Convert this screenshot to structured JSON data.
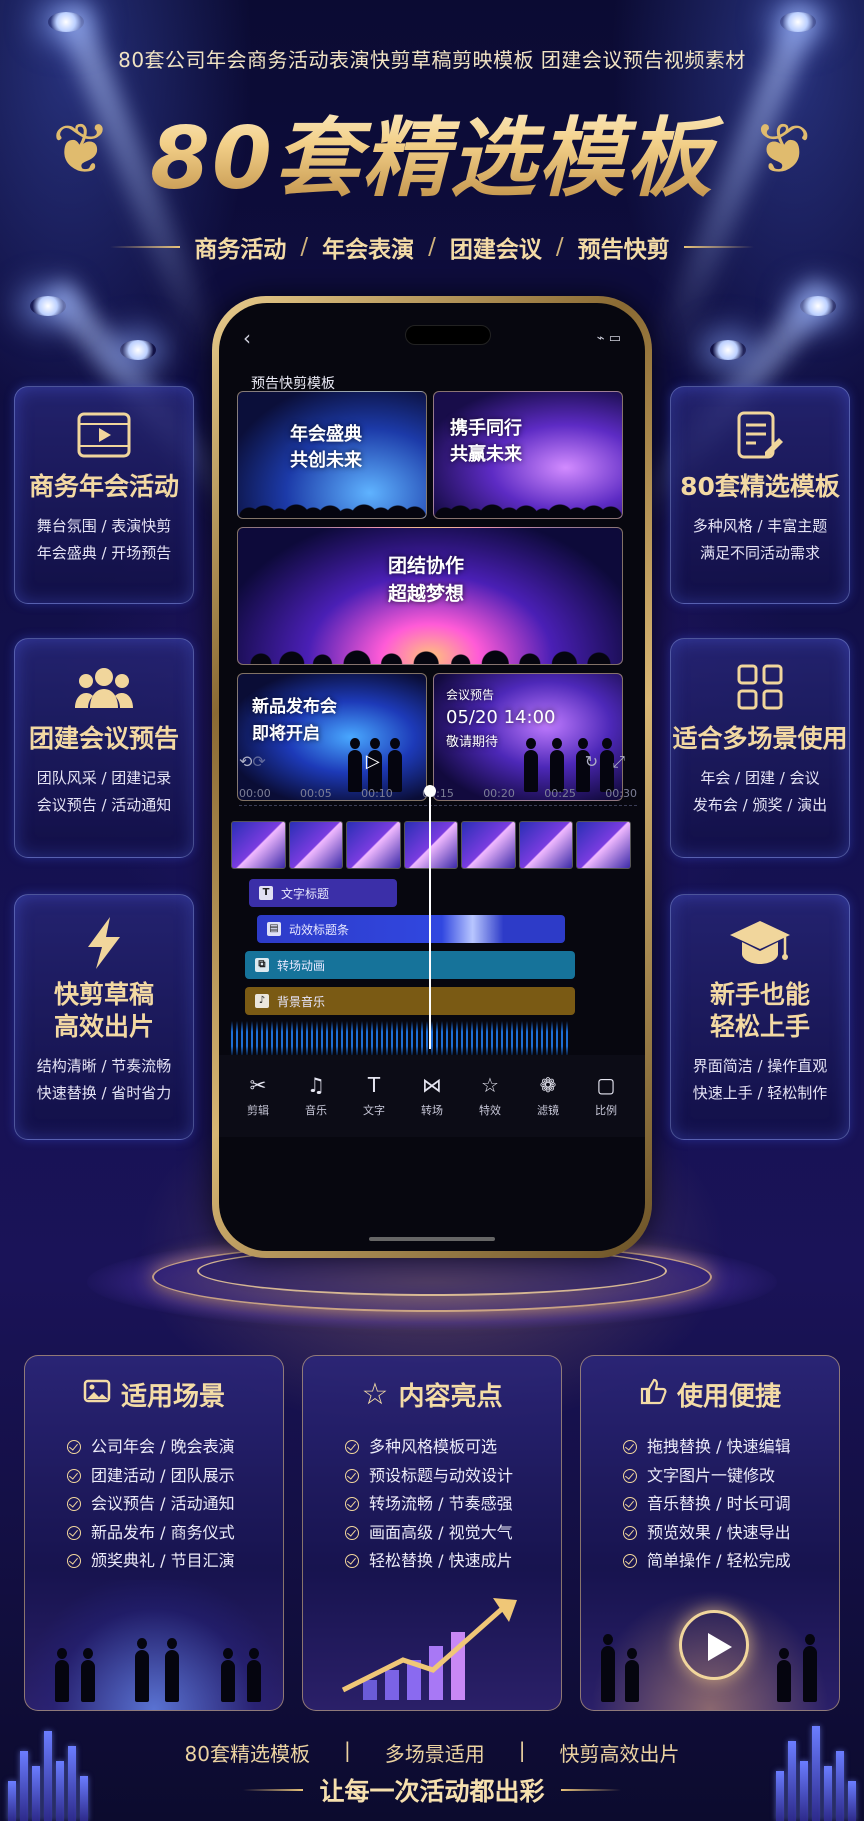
{
  "header": {
    "top_line": "80套公司年会商务活动表演快剪草稿剪映模板 团建会议预告视频素材",
    "headline": "80套精选模板",
    "sub_items": [
      "商务活动",
      "年会表演",
      "团建会议",
      "预告快剪"
    ],
    "separator": "/"
  },
  "left_cards": [
    {
      "icon": "video-play-icon",
      "title": "商务年会活动",
      "line1": "舞台氛围 / 表演快剪",
      "line2": "年会盛典 / 开场预告"
    },
    {
      "icon": "people-group-icon",
      "title": "团建会议预告",
      "line1": "团队风采 / 团建记录",
      "line2": "会议预告 / 活动通知"
    },
    {
      "icon": "lightning-icon",
      "title": "快剪草稿\n高效出片",
      "title_a": "快剪草稿",
      "title_b": "高效出片",
      "line1": "结构清晰 / 节奏流畅",
      "line2": "快速替换 / 省时省力"
    }
  ],
  "right_cards": [
    {
      "icon": "document-edit-icon",
      "title": "80套精选模板",
      "line1": "多种风格 / 丰富主题",
      "line2": "满足不同活动需求"
    },
    {
      "icon": "grid-icon",
      "title": "适合多场景使用",
      "line1": "年会 / 团建 / 会议",
      "line2": "发布会 / 颁奖 / 演出"
    },
    {
      "icon": "graduation-cap-icon",
      "title_a": "新手也能",
      "title_b": "轻松上手",
      "line1": "界面简洁 / 操作直观",
      "line2": "快速上手 / 轻松制作"
    }
  ],
  "phone": {
    "back_glyph": "‹",
    "status_right": "⌁ ▭",
    "section_title": "预告快剪模板",
    "templates": [
      {
        "line1": "年会盛典",
        "line2": "共创未来"
      },
      {
        "line1": "携手同行",
        "line2": "共赢未来"
      },
      {
        "line1": "团结协作",
        "line2": "超越梦想"
      },
      {
        "line1": "新品发布会",
        "line2": "即将开启"
      },
      {
        "line1": "会议预告",
        "line2": "05/20  14:00",
        "line3": "敬请期待"
      }
    ],
    "timeline_marks": [
      "00:00",
      "00:05",
      "00:10",
      "00:15",
      "00:20",
      "00:25",
      "00:30"
    ],
    "tracks": [
      {
        "icon": "T",
        "label": "文字标题",
        "color": "#3b2fa8"
      },
      {
        "icon": "▤",
        "label": "动效标题条",
        "color": "#2d3bc8"
      },
      {
        "icon": "⧉",
        "label": "转场动画",
        "color": "#16739a"
      },
      {
        "icon": "♪",
        "label": "背景音乐",
        "color": "#7a5a14"
      }
    ],
    "tools": [
      {
        "glyph": "✂",
        "label": "剪辑",
        "icon": "scissors-icon"
      },
      {
        "glyph": "♫",
        "label": "音乐",
        "icon": "music-icon"
      },
      {
        "glyph": "T",
        "label": "文字",
        "icon": "text-icon"
      },
      {
        "glyph": "⋈",
        "label": "转场",
        "icon": "transition-icon"
      },
      {
        "glyph": "☆",
        "label": "特效",
        "icon": "star-icon"
      },
      {
        "glyph": "❁",
        "label": "滤镜",
        "icon": "filter-icon"
      },
      {
        "glyph": "▢",
        "label": "比例",
        "icon": "ratio-icon"
      }
    ]
  },
  "bottom_cards": [
    {
      "icon": "image-icon",
      "glyph": "▣",
      "title": "适用场景",
      "items": [
        "公司年会 / 晚会表演",
        "团建活动 / 团队展示",
        "会议预告 / 活动通知",
        "新品发布 / 商务仪式",
        "颁奖典礼 / 节目汇演"
      ]
    },
    {
      "icon": "star-outline-icon",
      "glyph": "☆",
      "title": "内容亮点",
      "items": [
        "多种风格模板可选",
        "预设标题与动效设计",
        "转场流畅 / 节奏感强",
        "画面高级 / 视觉大气",
        "轻松替换 / 快速成片"
      ]
    },
    {
      "icon": "thumbs-up-icon",
      "glyph": "👍",
      "title": "使用便捷",
      "items": [
        "拖拽替换 / 快速编辑",
        "文字图片一键修改",
        "音乐替换 / 时长可调",
        "预览效果 / 快速导出",
        "简单操作 / 轻松完成"
      ]
    }
  ],
  "footer": {
    "tags": [
      "80套精选模板",
      "|",
      "多场景适用",
      "|",
      "快剪高效出片"
    ],
    "slogan": "让每一次活动都出彩"
  },
  "colors": {
    "gold": "#f3d9a3",
    "navy": "#0a0a2c",
    "accent_blue": "#2d3bc8"
  }
}
